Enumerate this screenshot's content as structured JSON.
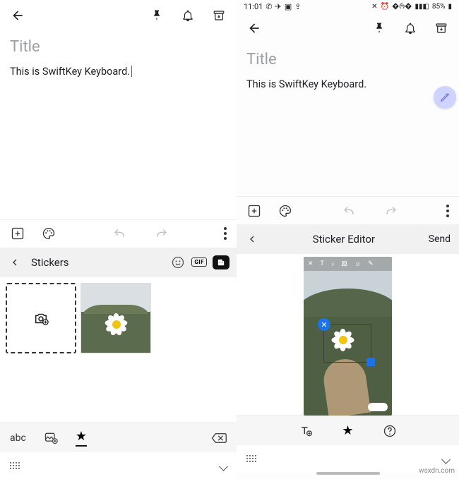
{
  "left": {
    "note": {
      "title_placeholder": "Title",
      "body": "This is SwiftKey Keyboard."
    },
    "stickers_bar": {
      "label": "Stickers",
      "gif": "GIF"
    },
    "mode_bar": {
      "abc": "abc"
    }
  },
  "right": {
    "status": {
      "time": "11:01",
      "battery": "85%"
    },
    "note": {
      "title_placeholder": "Title",
      "body": "This is SwiftKey Keyboard."
    },
    "editor_bar": {
      "title": "Sticker Editor",
      "send": "Send"
    }
  },
  "watermark": "wsxdn.com"
}
